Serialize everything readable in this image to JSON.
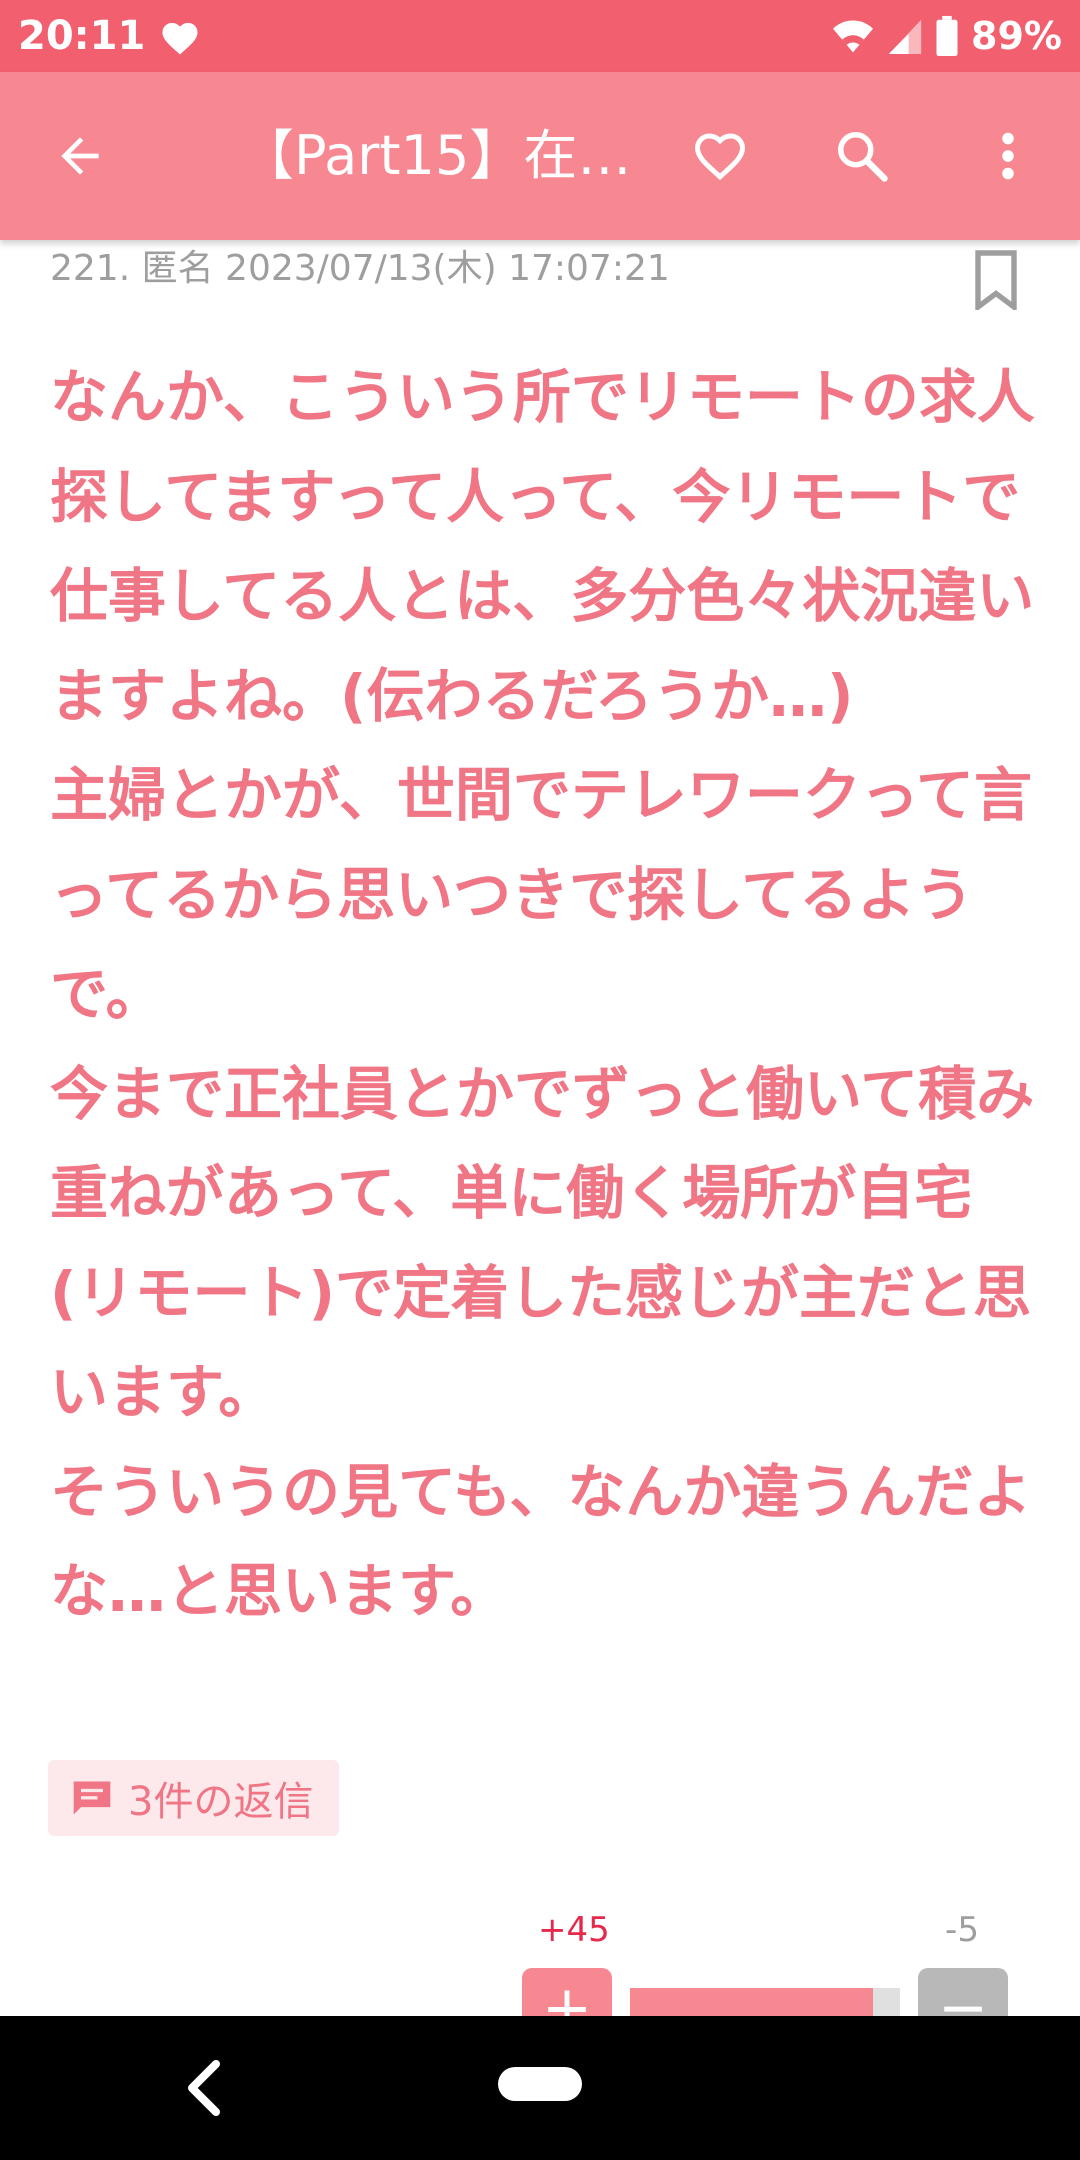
{
  "status_bar": {
    "time": "20:11",
    "battery": "89%"
  },
  "app_bar": {
    "title": "【Part15】在…"
  },
  "post": {
    "meta": "221. 匿名 2023/07/13(木) 17:07:21",
    "body": "なんか、こういう所でリモートの求人探してますって人って、今リモートで仕事してる人とは、多分色々状況違いますよね。(伝わるだろうか…)\n主婦とかが、世間でテレワークって言ってるから思いつきで探してるようで。\n今まで正社員とかでずっと働いて積み重ねがあって、単に働く場所が自宅(リモート)で定着した感じが主だと思います。\nそういうの見ても、なんか違うんだよな…と思います。",
    "reply_label": "3件の返信",
    "votes_plus": "+45",
    "votes_minus": "-5",
    "plus_label": "+",
    "minus_label": "−",
    "vote_ratio": 0.9
  },
  "colors": {
    "status_bar": "#f2606f",
    "app_bar": "#f78790",
    "body_text": "#f07585",
    "plus_count": "#e6294b"
  },
  "icons": {
    "status": [
      "heart-icon",
      "wifi-icon",
      "signal-icon",
      "battery-icon"
    ],
    "app_bar": [
      "back-arrow-icon",
      "heart-outline-icon",
      "search-icon",
      "more-vert-icon"
    ],
    "post": [
      "bookmark-icon",
      "comment-icon"
    ],
    "nav": [
      "nav-back-icon",
      "nav-home-pill"
    ]
  }
}
